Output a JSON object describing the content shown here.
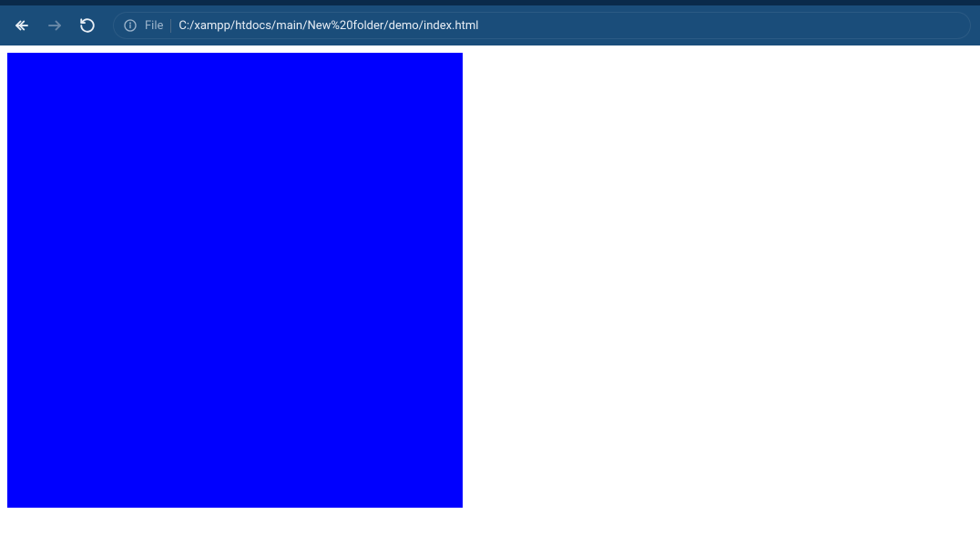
{
  "toolbar": {
    "file_label": "File",
    "url": "C:/xampp/htdocs/main/New%20folder/demo/index.html"
  },
  "content": {
    "box_color": "#0000ff"
  }
}
